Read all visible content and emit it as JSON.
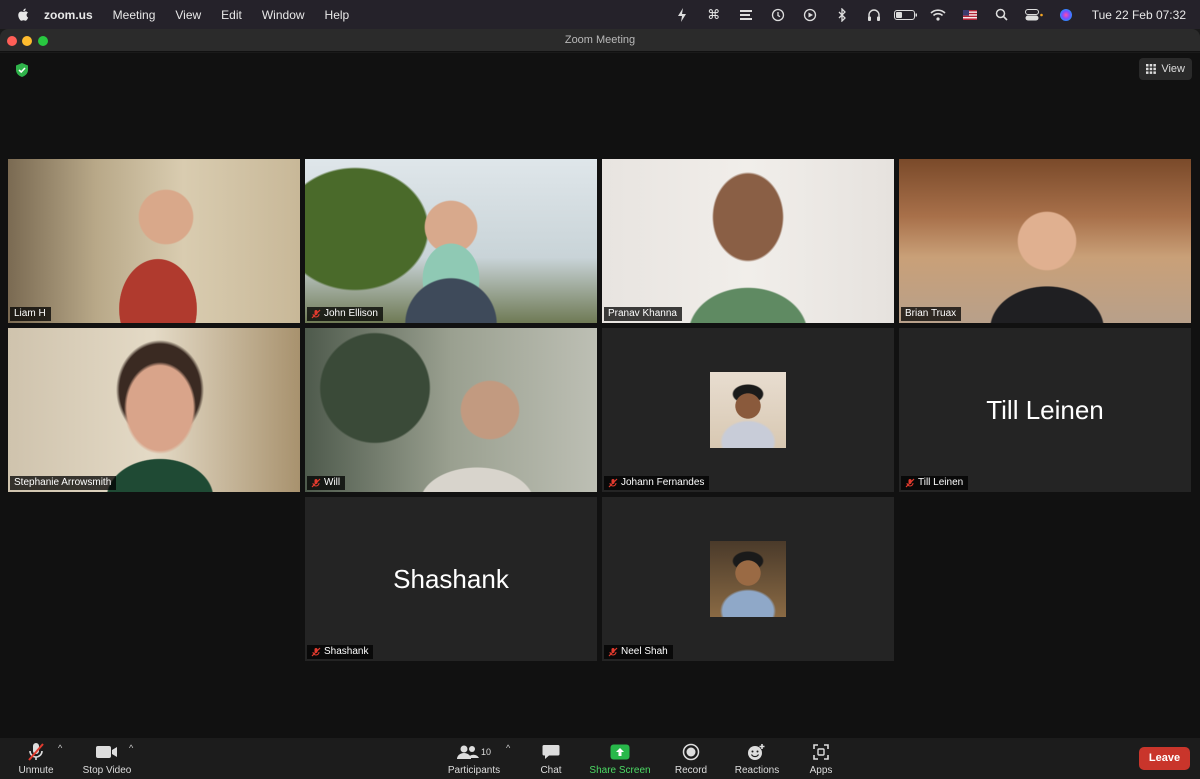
{
  "menubar": {
    "app_name": "zoom.us",
    "items": [
      "Meeting",
      "View",
      "Edit",
      "Window",
      "Help"
    ],
    "clock": "Tue 22 Feb  07:32"
  },
  "window": {
    "title": "Zoom Meeting",
    "view_label": "View"
  },
  "tiles": [
    {
      "name": "Liam H",
      "muted": false,
      "type": "video",
      "active": true
    },
    {
      "name": "John Ellison",
      "muted": true,
      "type": "video"
    },
    {
      "name": "Pranav Khanna",
      "muted": false,
      "type": "video"
    },
    {
      "name": "Brian Truax",
      "muted": false,
      "type": "video"
    },
    {
      "name": "Stephanie Arrowsmith",
      "muted": false,
      "type": "video"
    },
    {
      "name": "Will",
      "muted": true,
      "type": "video"
    },
    {
      "name": "Johann Fernandes",
      "muted": true,
      "type": "avatar"
    },
    {
      "name": "Till Leinen",
      "muted": true,
      "type": "name",
      "display_name": "Till Leinen"
    },
    {
      "name": "Shashank",
      "muted": true,
      "type": "name",
      "display_name": "Shashank"
    },
    {
      "name": "Neel Shah",
      "muted": true,
      "type": "avatar"
    }
  ],
  "toolbar": {
    "unmute": "Unmute",
    "stop_video": "Stop Video",
    "participants": "Participants",
    "participant_count": "10",
    "chat": "Chat",
    "share_screen": "Share Screen",
    "record": "Record",
    "reactions": "Reactions",
    "apps": "Apps",
    "leave": "Leave"
  },
  "colors": {
    "active_speaker": "#e8e27a",
    "leave": "#c9352b",
    "share": "#4cd964"
  }
}
